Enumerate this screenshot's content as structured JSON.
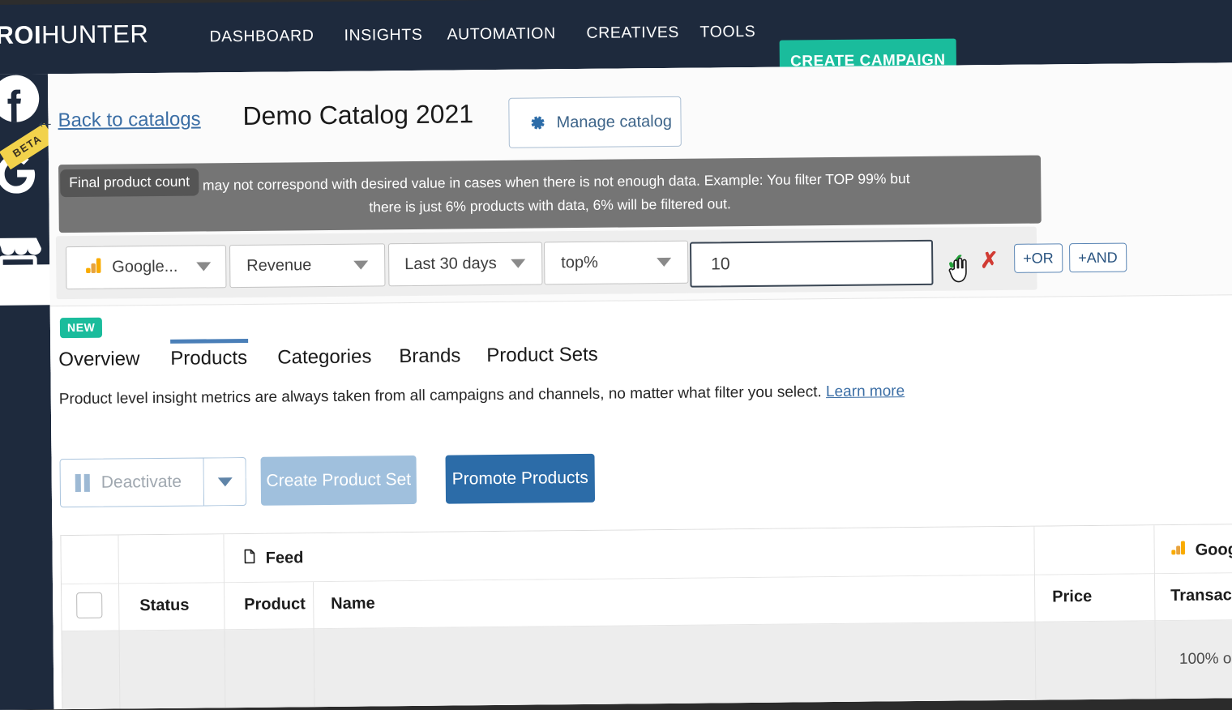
{
  "brand": {
    "name_bold": "ROI",
    "name_light": "HUNTER",
    "accent": "#1abc9c",
    "navy": "#1e2a3d"
  },
  "topnav": {
    "items": [
      {
        "label": "DASHBOARD",
        "active": false
      },
      {
        "label": "INSIGHTS",
        "active": true
      },
      {
        "label": "AUTOMATION",
        "active": false
      },
      {
        "label": "CREATIVES",
        "active": false
      },
      {
        "label": "TOOLS",
        "active": false
      }
    ],
    "cta_label": "CREATE CAMPAIGN"
  },
  "rail": {
    "items": [
      {
        "icon": "facebook-icon",
        "badge": null
      },
      {
        "icon": "google-icon",
        "badge": "BETA"
      },
      {
        "icon": "shop-icon",
        "badge": null
      }
    ],
    "beta_label": "BETA"
  },
  "header": {
    "back_label": "Back to catalogs",
    "back_icon": "arrow-left-icon",
    "catalog_title": "Demo Catalog 2021",
    "manage_label": "Manage catalog",
    "manage_icon": "gear-icon"
  },
  "tooltip": {
    "chip": "Final product count",
    "line1": "Final product count may not correspond with desired value in cases when there is not enough data. Example: You filter TOP 99% but",
    "line2": "there is just 6% products with data, 6% will be filtered out."
  },
  "filter": {
    "source": "Google...",
    "source_icon": "google-analytics-icon",
    "metric": "Revenue",
    "period": "Last 30 days",
    "operator": "top%",
    "value": "10",
    "value_placeholder": "",
    "confirm_icon": "check-icon",
    "cancel_icon": "cross-icon",
    "or_label": "+OR",
    "and_label": "+AND"
  },
  "content": {
    "new_badge": "NEW",
    "tabs": [
      {
        "label": "Overview",
        "active": false
      },
      {
        "label": "Products",
        "active": true
      },
      {
        "label": "Categories",
        "active": false
      },
      {
        "label": "Brands",
        "active": false
      },
      {
        "label": "Product Sets",
        "active": false
      }
    ],
    "info_text": "Product level insight metrics are always taken from all campaigns and channels, no matter what filter you select.",
    "learn_more": "Learn more",
    "actions": {
      "deactivate_label": "Deactivate",
      "deactivate_icon": "pause-icon",
      "create_set_label": "Create Product Set",
      "promote_label": "Promote Products"
    }
  },
  "table": {
    "group_headers": [
      {
        "label": "Feed",
        "icon": "document-icon"
      },
      {
        "label": "Googl",
        "icon": "google-analytics-icon"
      }
    ],
    "columns": [
      "",
      "Status",
      "Product",
      "Name",
      "Price",
      "Transactio"
    ],
    "rows": [
      {
        "pct": "100% o"
      }
    ]
  }
}
